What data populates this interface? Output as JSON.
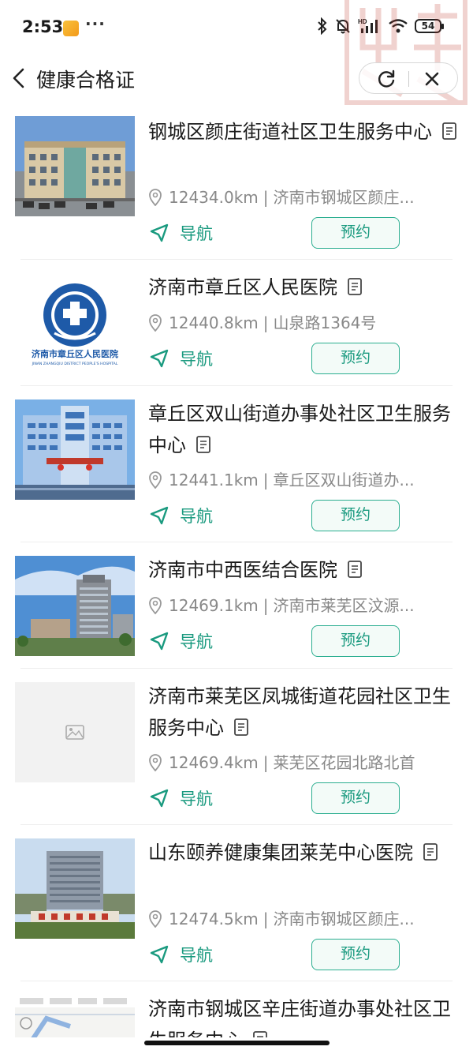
{
  "status_bar": {
    "time": "2:53",
    "more": "···",
    "battery": "54"
  },
  "header": {
    "title": "健康合格证"
  },
  "colors": {
    "accent": "#1a9a7f",
    "accent_border": "#2bae90",
    "text_gray": "#888888"
  },
  "list": {
    "items": [
      {
        "name": "钢城区颜庄街道社区卫生服务中心",
        "distance": "12434.0km",
        "address": "济南市钢城区颜庄...",
        "nav_label": "导航",
        "book_label": "预约",
        "thumb": "building-photo"
      },
      {
        "name": "济南市章丘区人民医院",
        "distance": "12440.8km",
        "address": "山泉路1364号",
        "nav_label": "导航",
        "book_label": "预约",
        "thumb": "hospital-logo",
        "logo_text": "济南市章丘区人民医院",
        "logo_subtext": "JINAN ZHANGQIU DISTRICT PEOPLE'S HOSPITAL"
      },
      {
        "name": "章丘区双山街道办事处社区卫生服务中心",
        "distance": "12441.1km",
        "address": "章丘区双山街道办...",
        "nav_label": "导航",
        "book_label": "预约",
        "thumb": "building-photo"
      },
      {
        "name": "济南市中西医结合医院",
        "distance": "12469.1km",
        "address": "济南市莱芜区汶源...",
        "nav_label": "导航",
        "book_label": "预约",
        "thumb": "building-photo"
      },
      {
        "name": "济南市莱芜区凤城街道花园社区卫生服务中心",
        "distance": "12469.4km",
        "address": "莱芜区花园北路北首",
        "nav_label": "导航",
        "book_label": "预约",
        "thumb": "image-placeholder"
      },
      {
        "name": "山东颐养健康集团莱芜中心医院",
        "distance": "12474.5km",
        "address": "济南市钢城区颜庄...",
        "nav_label": "导航",
        "book_label": "预约",
        "thumb": "building-photo"
      },
      {
        "name": "济南市钢城区辛庄街道办事处社区卫生服务中心",
        "distance": "",
        "address": "",
        "nav_label": "",
        "book_label": "",
        "thumb": "map-screenshot"
      }
    ]
  }
}
